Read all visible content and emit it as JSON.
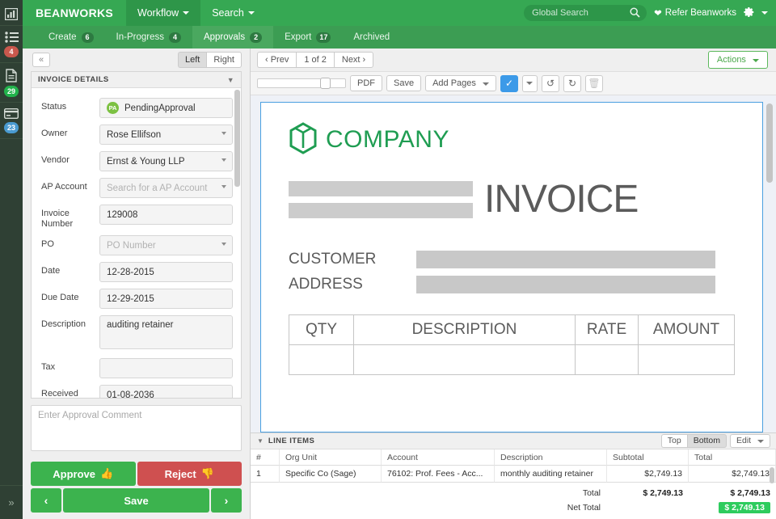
{
  "rail": {
    "items": [
      {
        "name": "dashboard",
        "icon": "bar-chart-icon",
        "badge": null,
        "badge_color": null
      },
      {
        "name": "tasks",
        "icon": "list-icon",
        "badge": "4",
        "badge_color": "#c9584d"
      },
      {
        "name": "invoices",
        "icon": "document-icon",
        "badge": "29",
        "badge_color": "#22b24c"
      },
      {
        "name": "payments",
        "icon": "credit-card-icon",
        "badge": "23",
        "badge_color": "#4a9bd1"
      }
    ],
    "expand_label": "»"
  },
  "topbar": {
    "brand": "BEANWORKS",
    "nav": [
      {
        "label": "Workflow",
        "active": true
      },
      {
        "label": "Search",
        "active": false
      }
    ],
    "search_placeholder": "Global Search",
    "search_value": "",
    "refer_label": "Refer Beanworks",
    "accent": "#36a853"
  },
  "tabs": [
    {
      "label": "Create",
      "badge": "6",
      "active": false
    },
    {
      "label": "In-Progress",
      "badge": "4",
      "active": false
    },
    {
      "label": "Approvals",
      "badge": "2",
      "active": true
    },
    {
      "label": "Export",
      "badge": "17",
      "active": false
    },
    {
      "label": "Archived",
      "badge": null,
      "active": false
    }
  ],
  "left_panel": {
    "collapse_label": "«",
    "side_toggle": [
      {
        "label": "Left",
        "active": true
      },
      {
        "label": "Right",
        "active": false
      }
    ],
    "card_title": "INVOICE DETAILS",
    "fields": {
      "status_label": "Status",
      "status_initials": "PA",
      "status_value": "PendingApproval",
      "owner_label": "Owner",
      "owner_value": "Rose Ellifson",
      "vendor_label": "Vendor",
      "vendor_value": "Ernst & Young LLP",
      "ap_account_label": "AP Account",
      "ap_account_placeholder": "Search for a AP Account",
      "ap_account_value": "",
      "invoice_number_label": "Invoice Number",
      "invoice_number_value": "129008",
      "po_label": "PO",
      "po_placeholder": "PO Number",
      "po_value": "",
      "date_label": "Date",
      "date_value": "12-28-2015",
      "due_date_label": "Due Date",
      "due_date_value": "12-29-2015",
      "description_label": "Description",
      "description_value": "auditing retainer",
      "tax_label": "Tax",
      "tax_value": "",
      "received_label": "Received",
      "received_value": "01-08-2036"
    },
    "comment_placeholder": "Enter Approval Comment",
    "comment_value": "",
    "approve_label": "Approve",
    "reject_label": "Reject",
    "prev_label": "‹",
    "save_label": "Save",
    "next_label": "›"
  },
  "right_panel": {
    "pager": {
      "prev_label": "‹ Prev",
      "page_label": "1 of 2",
      "next_label": "Next ›"
    },
    "actions_label": "Actions",
    "toolbar": {
      "pdf_label": "PDF",
      "save_label": "Save",
      "add_pages_label": "Add Pages",
      "checkbox_checked": true,
      "rotate_left_icon": "rotate-left-icon",
      "rotate_right_icon": "rotate-right-icon",
      "delete_icon": "trash-icon"
    }
  },
  "document": {
    "logo_text": "COMPANY",
    "logo_color": "#1f9d52",
    "title": "INVOICE",
    "customer_label": "CUSTOMER",
    "address_label": "ADDRESS",
    "table_headers": [
      "QTY",
      "DESCRIPTION",
      "RATE",
      "AMOUNT"
    ]
  },
  "line_items": {
    "title": "LINE ITEMS",
    "view_toggle": [
      {
        "label": "Top",
        "active": false
      },
      {
        "label": "Bottom",
        "active": true
      }
    ],
    "edit_label": "Edit",
    "columns": [
      "#",
      "Org Unit",
      "Account",
      "Description",
      "Subtotal",
      "Total"
    ],
    "rows": [
      {
        "num": "1",
        "org_unit": "Specific Co (Sage)",
        "account": "76102: Prof. Fees - Acc...",
        "description": "monthly auditing retainer",
        "subtotal": "$2,749.13",
        "total": "$2,749.13"
      }
    ],
    "total_label": "Total",
    "total_subtotal": "$ 2,749.13",
    "total_total": "$ 2,749.13",
    "net_total_label": "Net Total",
    "net_total_value": "$ 2,749.13",
    "net_total_color": "#2ecc5e"
  }
}
